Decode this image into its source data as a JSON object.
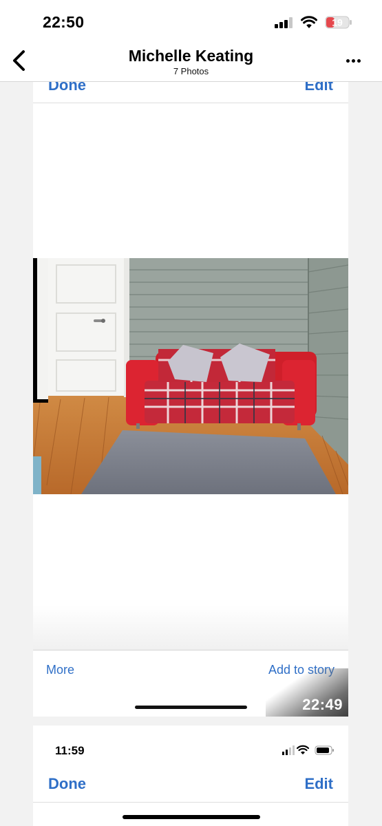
{
  "status_bar": {
    "time": "22:50",
    "battery_level": "19",
    "battery_color": "#e5484d"
  },
  "header": {
    "title": "Michelle Keating",
    "subtitle": "7 Photos"
  },
  "screenshot_1": {
    "top_nav": {
      "done_label": "Done",
      "edit_label": "Edit"
    },
    "toolbar": {
      "more_label": "More",
      "add_to_story_label": "Add to story"
    },
    "timestamp": "22:49"
  },
  "screenshot_2": {
    "status_time": "11:59",
    "done_label": "Done",
    "edit_label": "Edit"
  },
  "colors": {
    "accent_blue": "#2f6fc7",
    "sofa_red": "#d8202c"
  }
}
